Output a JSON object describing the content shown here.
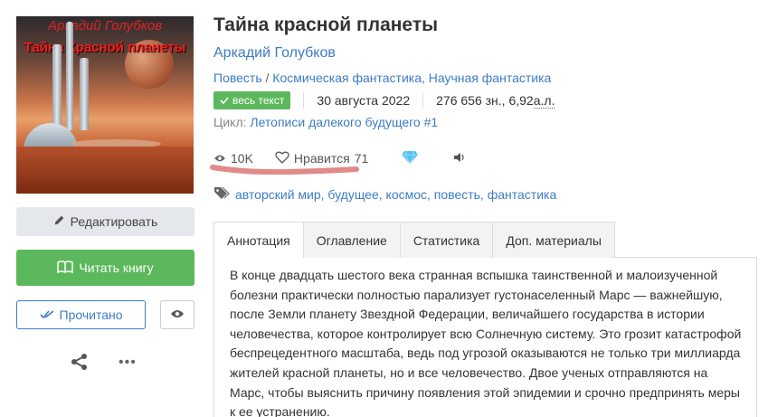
{
  "cover": {
    "author_text": "Аркадий Голубков",
    "title_text": "Тайна Красной планеты"
  },
  "sidebar": {
    "edit_label": "Редактировать",
    "read_label": "Читать книгу",
    "done_label": "Прочитано"
  },
  "book": {
    "title": "Тайна красной планеты",
    "author": "Аркадий Голубков",
    "form": "Повесть",
    "genre_separator": " / ",
    "genre_1": "Космическая фантастика",
    "genre_comma": ", ",
    "genre_2": "Научная фантастика",
    "status_badge": "весь текст",
    "date": "30 августа 2022",
    "size_text": "276 656 зн., 6,92 ",
    "size_unit": "а.л.",
    "cycle_label": "Цикл: ",
    "cycle_name": "Летописи далекого будущего #1"
  },
  "stats": {
    "views": "10K",
    "likes_label": "Нравится",
    "likes_count": "71"
  },
  "tags": "авторский мир, будущее, космос, повесть, фантастика",
  "tabs": [
    {
      "label": "Аннотация"
    },
    {
      "label": "Оглавление"
    },
    {
      "label": "Статистика"
    },
    {
      "label": "Доп. материалы"
    }
  ],
  "annotation": "В конце двадцать шестого века странная вспышка таинственной и малоизученной болезни практически полностью парализует густонаселенный Марс — важнейшую, после Земли планету Звездной Федерации, величайшего государства в истории человечества, которое контролирует всю Солнечную систему. Это грозит катастрофой беспрецедентного масштаба, ведь под угрозой оказываются не только три миллиарда жителей красной планеты, но и все человечество. Двое ученых отправляются на Марс, чтобы выяснить причину появления этой эпидемии и срочно предпринять меры к ее устранению.",
  "colors": {
    "accent": "#3d7cc4",
    "success": "#5cb85c",
    "diamond": "#4fc3f7",
    "highlight_stroke": "#e08a8a"
  }
}
